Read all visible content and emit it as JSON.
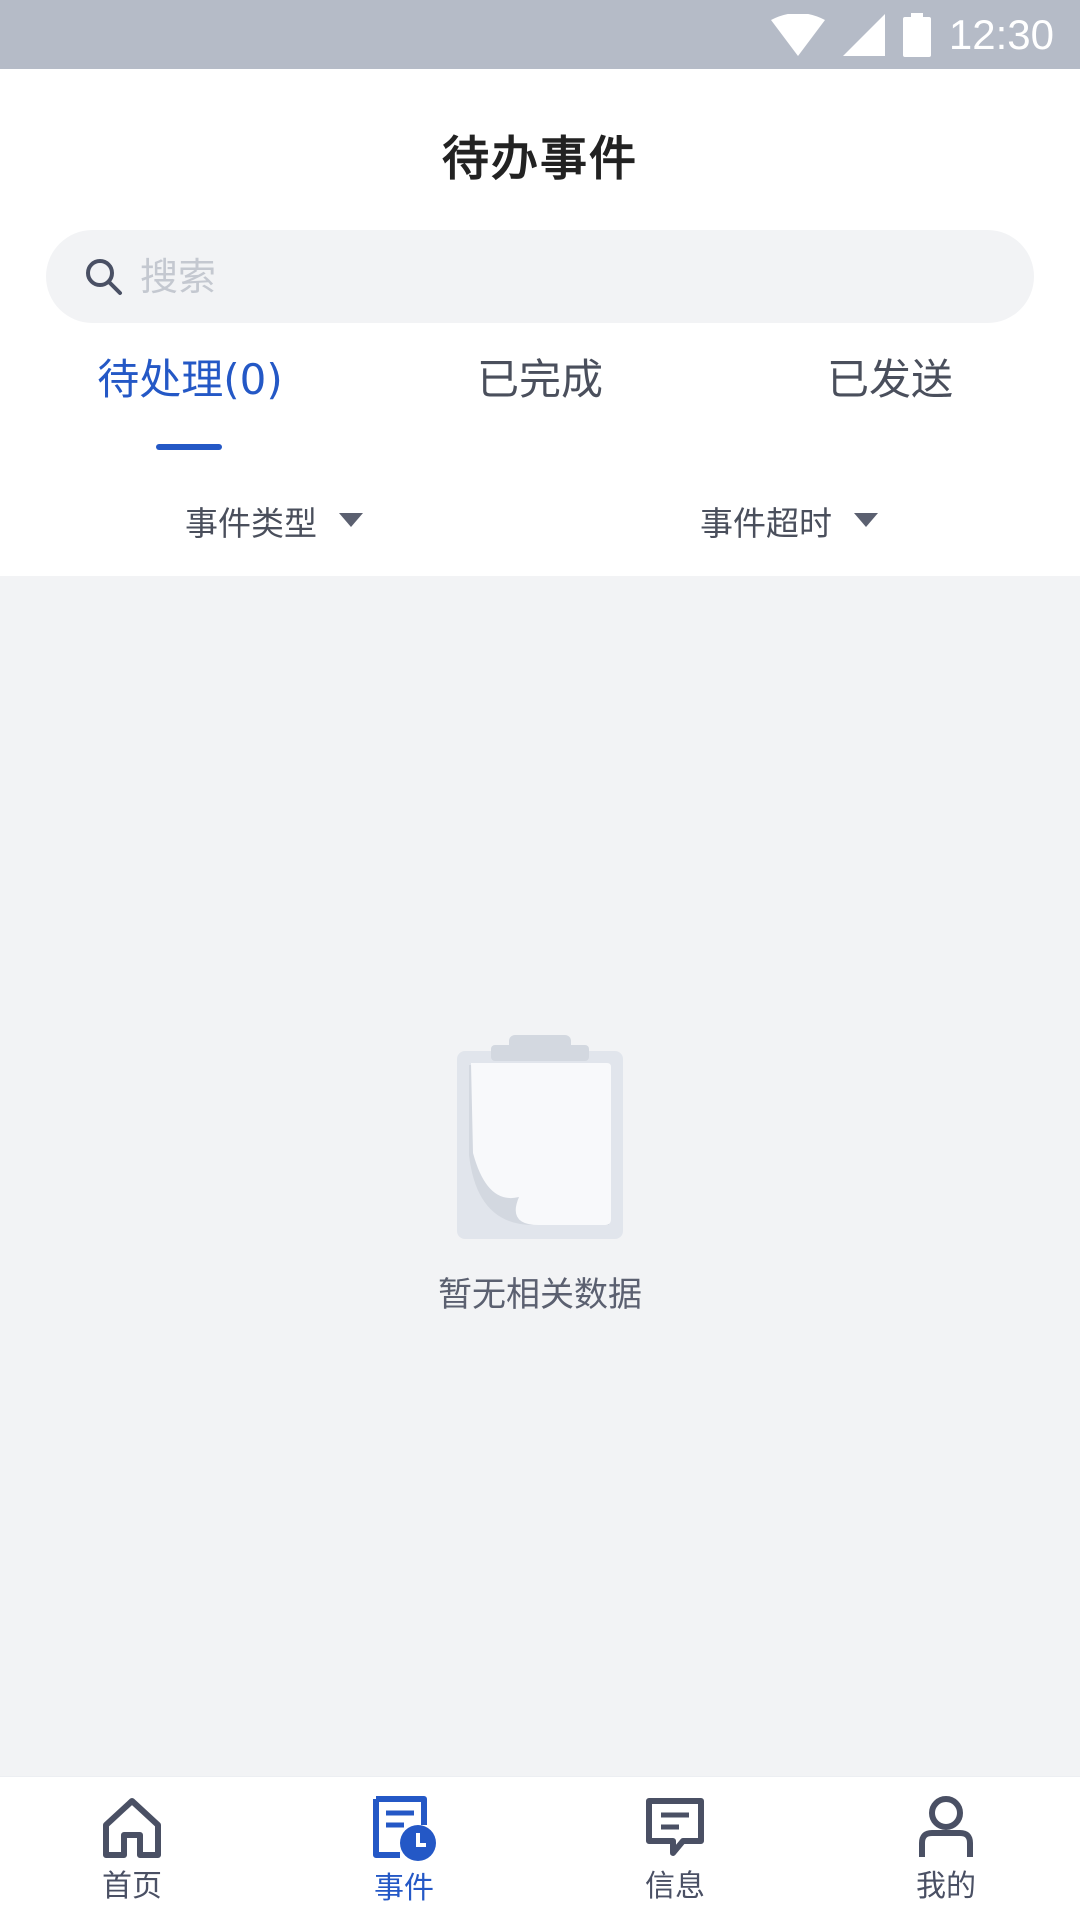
{
  "status_bar": {
    "time": "12:30"
  },
  "header": {
    "title": "待办事件"
  },
  "search": {
    "placeholder": "搜索",
    "value": ""
  },
  "tabs": [
    {
      "label": "待处理(0)",
      "active": true
    },
    {
      "label": "已完成",
      "active": false
    },
    {
      "label": "已发送",
      "active": false
    }
  ],
  "filters": [
    {
      "label": "事件类型"
    },
    {
      "label": "事件超时"
    }
  ],
  "empty": {
    "message": "暂无相关数据"
  },
  "bottom_nav": [
    {
      "label": "首页",
      "icon": "home-icon",
      "active": false
    },
    {
      "label": "事件",
      "icon": "event-icon",
      "active": true
    },
    {
      "label": "信息",
      "icon": "message-icon",
      "active": false
    },
    {
      "label": "我的",
      "icon": "profile-icon",
      "active": false
    }
  ],
  "colors": {
    "accent": "#2458c6",
    "status_bar": "#b5bbc7",
    "background": "#f2f3f5"
  }
}
